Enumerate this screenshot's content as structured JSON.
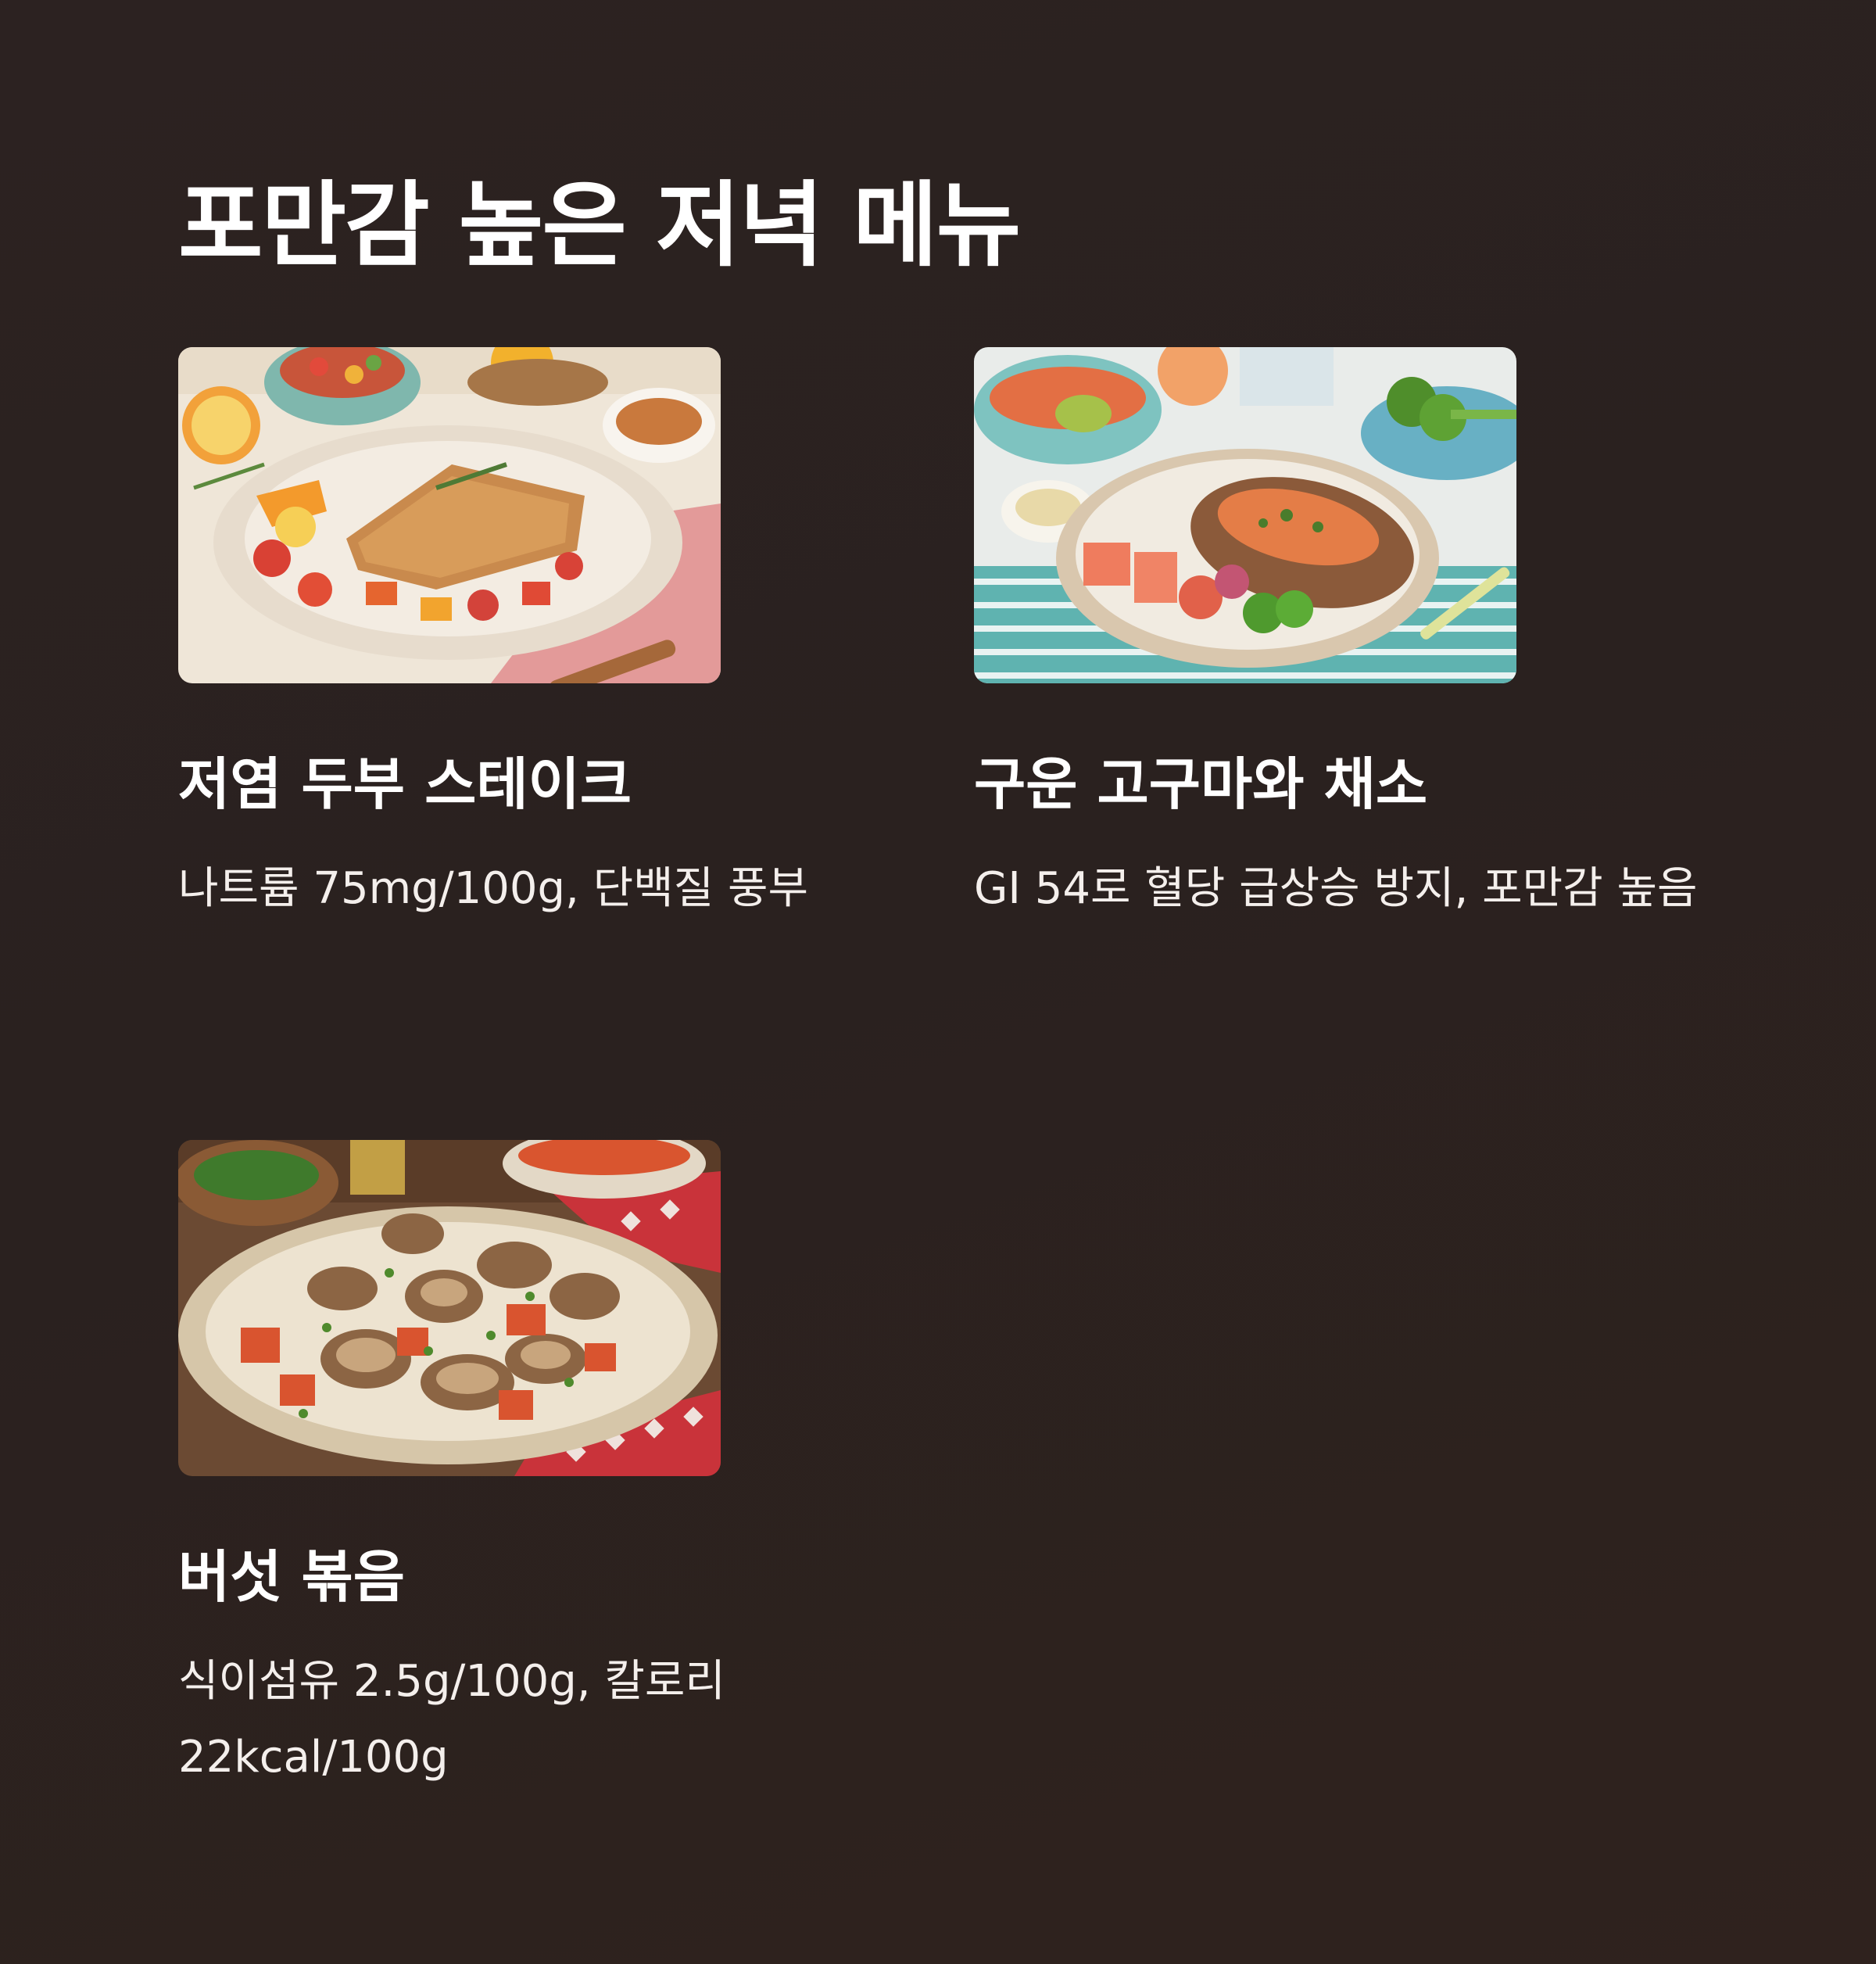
{
  "page": {
    "title": "포만감 높은 저녁 메뉴"
  },
  "colors": {
    "background": "#2b2220",
    "text": "#ffffff"
  },
  "menu_items": [
    {
      "title": "저염 두부 스테이크",
      "description": "나트륨 75mg/100g, 단백질 풍부",
      "image_icon": "tofu-steak-plate-photo"
    },
    {
      "title": "구운 고구마와 채소",
      "description": "GI 54로 혈당 급상승 방지, 포만감 높음",
      "image_icon": "baked-sweet-potato-plate-photo"
    },
    {
      "title": "버섯 볶음",
      "description": "식이섬유 2.5g/100g, 칼로리 22kcal/100g",
      "image_icon": "mushroom-stir-fry-plate-photo"
    }
  ]
}
